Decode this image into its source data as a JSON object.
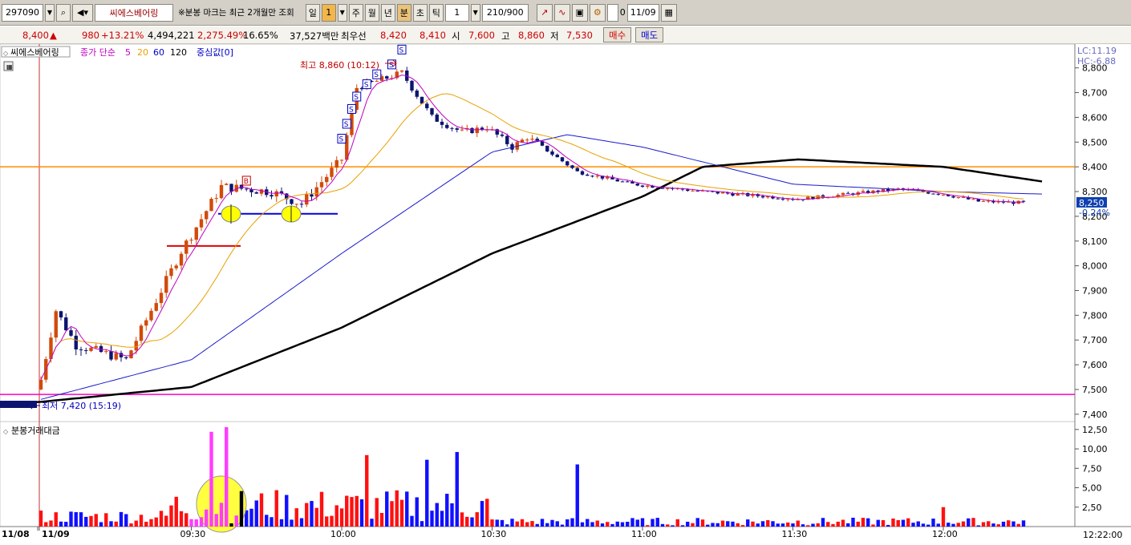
{
  "toolbar": {
    "code": "297090",
    "name": "씨에스베어링",
    "note": "※분봉 마크는 최근 2개월만 조회",
    "period_buttons": [
      "일",
      "1",
      "주",
      "월",
      "년",
      "분",
      "초",
      "틱"
    ],
    "interval": "1",
    "count": "210/900",
    "date_checkbox": "0",
    "date": "11/09"
  },
  "quote": {
    "price": "8,400",
    "change_arrow": "▲",
    "change": "980",
    "change_rate": "+13.21%",
    "volume": "4,494,221",
    "volume_rate": "2,275.49%",
    "turnover": "16.65%",
    "amount": "37,527백만",
    "best_label": "최우선",
    "ask": "8,420",
    "bid": "8,410",
    "open_label": "시",
    "open": "7,600",
    "high_label": "고",
    "high": "8,860",
    "low_label": "저",
    "low": "7,530",
    "buy_button": "매수",
    "sell_button": "매도"
  },
  "legend": {
    "name": "씨에스베어링",
    "ma_label": "종가 단순",
    "ma_periods": [
      "5",
      "20",
      "60",
      "120"
    ],
    "center": "중심값[0]",
    "volume_title": "분봉거래대금"
  },
  "annotations": {
    "high": "최고 8,860 (10:12)",
    "low": "최저 7,420 (15:19)",
    "lc": "LC:11.19",
    "hc": "HC:-6.88",
    "last_price": "8,250",
    "last_rate": "-0.24%",
    "clock": "12:22:00"
  },
  "colors": {
    "up": "#d24a0a",
    "down": "#0d1470",
    "ma5": "#c000c0",
    "ma20": "#e8a000",
    "ma60": "#0000c8",
    "ma120": "#000000",
    "orange_line": "#ff8c00",
    "magenta_line": "#ff00c8",
    "volume_up": "#ff1010",
    "volume_down": "#1010ff"
  },
  "icons": [
    "search-icon",
    "speaker-icon",
    "chart-icon",
    "save-icon",
    "gear-icon",
    "calendar-icon",
    "grid-icon"
  ],
  "chart_data": {
    "type": "line",
    "price_axis": {
      "ticks": [
        "8,800",
        "8,700",
        "8,600",
        "8,500",
        "8,400",
        "8,300",
        "8,200",
        "8,100",
        "8,000",
        "7,900",
        "7,800",
        "7,700",
        "7,600",
        "7,500",
        "7,400"
      ],
      "range": [
        7380,
        8880
      ]
    },
    "volume_axis": {
      "ticks": [
        "12,50",
        "10,00",
        "7,50",
        "5,00",
        "2,50"
      ],
      "range": [
        0,
        13
      ]
    },
    "time_axis": [
      "11/08",
      "11/09",
      "09:30",
      "10:00",
      "10:30",
      "11:00",
      "11:30",
      "12:00"
    ],
    "reference_lines": {
      "orange": 8400,
      "magenta": 7480,
      "red_segment": 8080,
      "blue_segment": 8210
    },
    "price_key_points": [
      {
        "time": "09:00",
        "price": 7540
      },
      {
        "time": "09:03",
        "price": 7820
      },
      {
        "time": "09:07",
        "price": 7680
      },
      {
        "time": "09:17",
        "price": 7620
      },
      {
        "time": "09:28",
        "price": 8060
      },
      {
        "time": "09:36",
        "price": 8320
      },
      {
        "time": "09:46",
        "price": 8300
      },
      {
        "time": "09:52",
        "price": 8250
      },
      {
        "time": "10:00",
        "price": 8430
      },
      {
        "time": "10:03",
        "price": 8720
      },
      {
        "time": "10:12",
        "price": 8780
      },
      {
        "time": "10:18",
        "price": 8600
      },
      {
        "time": "10:24",
        "price": 8540
      },
      {
        "time": "10:29",
        "price": 8560
      },
      {
        "time": "10:34",
        "price": 8480
      },
      {
        "time": "10:37",
        "price": 8520
      },
      {
        "time": "10:40",
        "price": 8480
      },
      {
        "time": "10:47",
        "price": 8380
      },
      {
        "time": "10:58",
        "price": 8330
      },
      {
        "time": "11:12",
        "price": 8300
      },
      {
        "time": "11:31",
        "price": 8270
      },
      {
        "time": "11:51",
        "price": 8310
      },
      {
        "time": "12:00",
        "price": 8290
      },
      {
        "time": "12:07",
        "price": 8260
      },
      {
        "time": "12:16",
        "price": 8255
      }
    ],
    "ma120_points": [
      {
        "time": "09:00",
        "price": 7450
      },
      {
        "time": "09:30",
        "price": 7510
      },
      {
        "time": "10:00",
        "price": 7750
      },
      {
        "time": "10:30",
        "price": 8050
      },
      {
        "time": "11:00",
        "price": 8280
      },
      {
        "time": "11:12",
        "price": 8400
      },
      {
        "time": "11:31",
        "price": 8430
      },
      {
        "time": "12:00",
        "price": 8400
      },
      {
        "time": "12:20",
        "price": 8340
      }
    ],
    "ma60_points": [
      {
        "time": "09:00",
        "price": 7460
      },
      {
        "time": "09:30",
        "price": 7620
      },
      {
        "time": "10:00",
        "price": 8050
      },
      {
        "time": "10:30",
        "price": 8460
      },
      {
        "time": "10:45",
        "price": 8530
      },
      {
        "time": "11:00",
        "price": 8480
      },
      {
        "time": "11:30",
        "price": 8330
      },
      {
        "time": "12:00",
        "price": 8300
      },
      {
        "time": "12:20",
        "price": 8290
      }
    ],
    "volume_key_points": [
      {
        "time": "09:34",
        "value": 12.2
      },
      {
        "time": "09:37",
        "value": 12.8
      },
      {
        "time": "10:05",
        "value": 9.2
      },
      {
        "time": "10:17",
        "value": 8.6
      },
      {
        "time": "10:23",
        "value": 9.6
      },
      {
        "time": "10:47",
        "value": 8.0
      },
      {
        "time": "12:00",
        "value": 2.5
      }
    ]
  }
}
